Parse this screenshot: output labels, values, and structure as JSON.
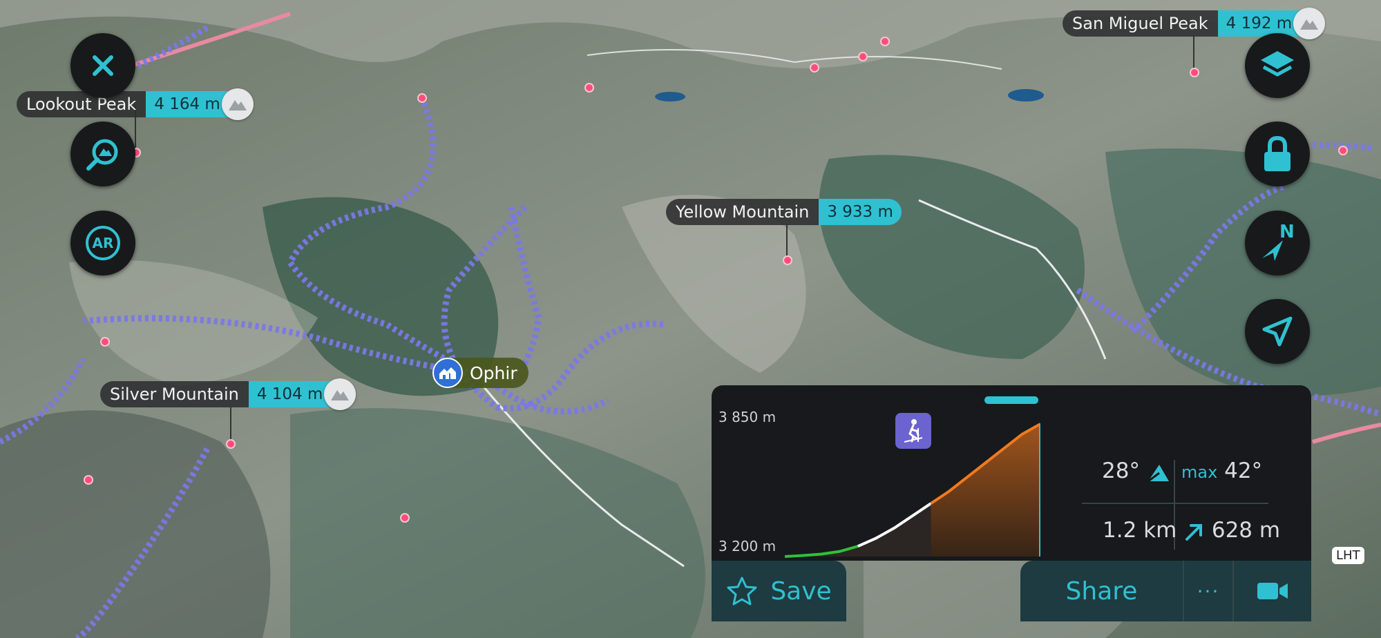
{
  "peaks": [
    {
      "name": "Lookout Peak",
      "elevation": "4 164 m"
    },
    {
      "name": "San Miguel Peak",
      "elevation": "4 192 m"
    },
    {
      "name": "Yellow Mountain",
      "elevation": "3 933 m"
    },
    {
      "name": "Silver Mountain",
      "elevation": "4 104 m"
    }
  ],
  "town": {
    "name": "Ophir"
  },
  "map_controls": {
    "close_icon": "close-icon",
    "peak_search_icon": "peak-search-icon",
    "ar_label": "AR",
    "layers_icon": "layers-icon",
    "lock_icon": "lock-icon",
    "compass_label": "N",
    "locate_icon": "location-arrow-icon"
  },
  "elevation_profile": {
    "max_label": "3 850 m",
    "min_label": "3 200 m",
    "activity_icon": "ski-touring-icon",
    "slope": "28°",
    "max_slope_label": "max",
    "max_slope": "42°",
    "distance": "1.2 km",
    "ascent": "628 m",
    "profile": [
      3200,
      3205,
      3212,
      3225,
      3250,
      3290,
      3340,
      3400,
      3460,
      3520,
      3590,
      3660,
      3730,
      3800,
      3850
    ],
    "segments": [
      {
        "from": 0,
        "to": 4,
        "color": "#2ec23a"
      },
      {
        "from": 4,
        "to": 8,
        "color": "#ffffff"
      },
      {
        "from": 8,
        "to": 14,
        "color": "#f07a1f"
      }
    ]
  },
  "actions": {
    "save_label": "Save",
    "share_label": "Share",
    "more_label": "···",
    "video_icon": "video-camera-icon"
  },
  "map_tag": "LHT",
  "colors": {
    "accent": "#2fc1d1",
    "trail": "#7b78e6",
    "road": "#e88aa0"
  }
}
